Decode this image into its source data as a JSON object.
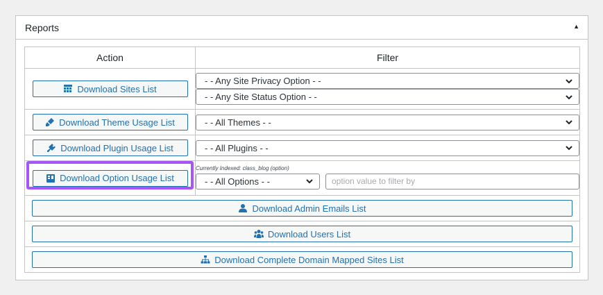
{
  "panel": {
    "title": "Reports",
    "toggle": "▲"
  },
  "table": {
    "headers": {
      "action": "Action",
      "filter": "Filter"
    }
  },
  "rows": {
    "sites": {
      "button": "Download Sites List",
      "icon": "table-grid-icon",
      "selects": [
        "- - Any Site Privacy Option - -",
        "- - Any Site Status Option - -"
      ]
    },
    "theme": {
      "button": "Download Theme Usage List",
      "icon": "paint-brush-icon",
      "select": "- - All Themes - -"
    },
    "plugin": {
      "button": "Download Plugin Usage List",
      "icon": "plugin-icon",
      "select": "- - All Plugins - -"
    },
    "option": {
      "button": "Download Option Usage List",
      "icon": "option-list-icon",
      "note": "Currently Indexed: class_blog (option)",
      "select": "- - All Options - -",
      "value_placeholder": "option value to filter by"
    },
    "admin_emails": {
      "button": "Download Admin Emails List",
      "icon": "admin-user-icon"
    },
    "users": {
      "button": "Download Users List",
      "icon": "users-group-icon"
    },
    "domain_mapped": {
      "button": "Download Complete Domain Mapped Sites List",
      "icon": "sitemap-icon"
    }
  },
  "colors": {
    "accent": "#2271b1",
    "highlight": "#a855f7",
    "background": "#f0f0f1"
  }
}
